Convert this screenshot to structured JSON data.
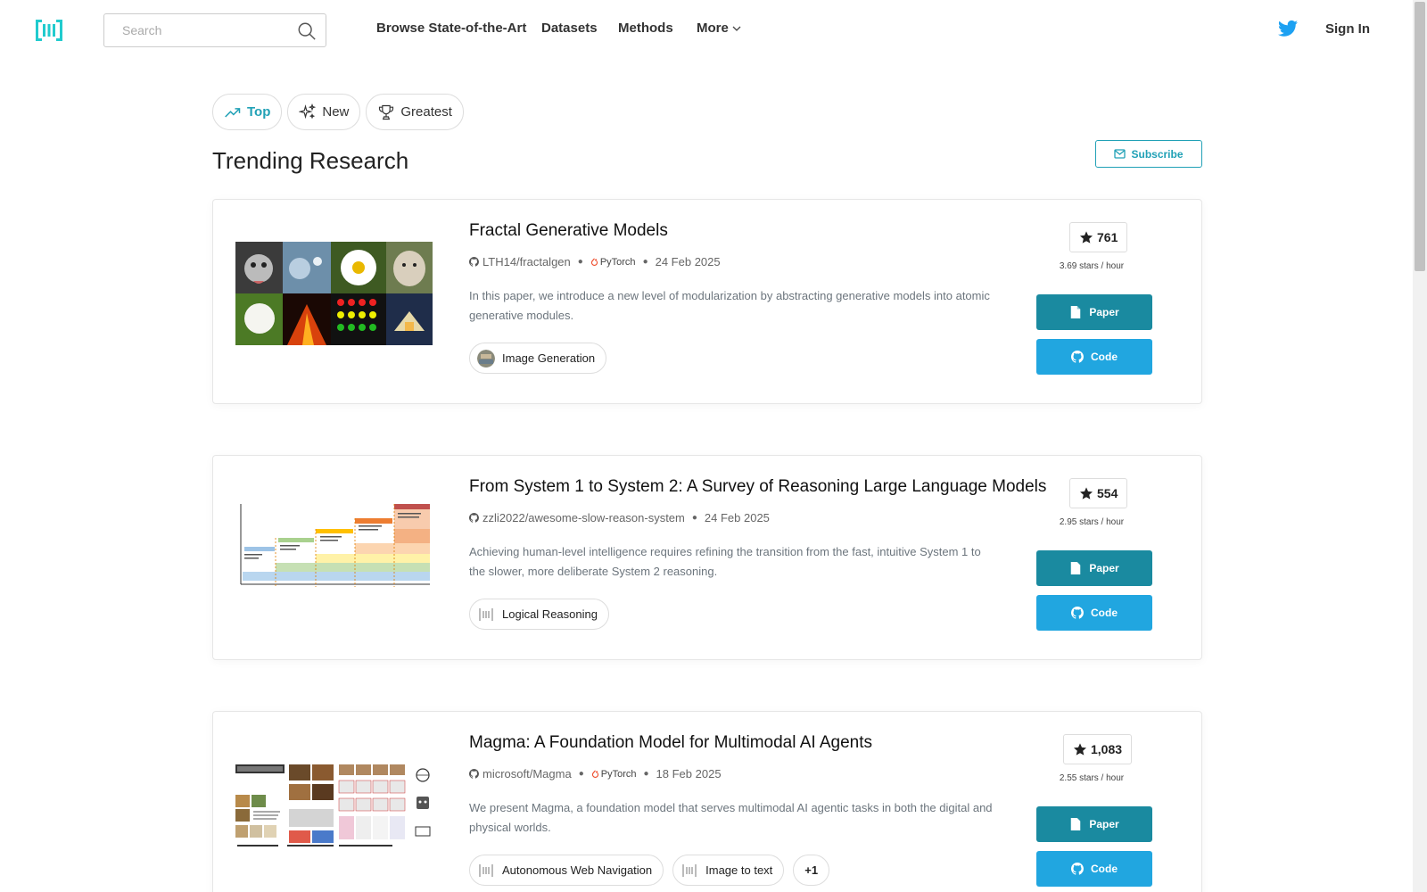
{
  "nav": {
    "search_placeholder": "Search",
    "links": [
      "Browse State-of-the-Art",
      "Datasets",
      "Methods",
      "More"
    ],
    "sign_in": "Sign In"
  },
  "tabs": [
    {
      "label": "Top",
      "icon": "trending-up-icon",
      "active": true
    },
    {
      "label": "New",
      "icon": "sparkles-icon",
      "active": false
    },
    {
      "label": "Greatest",
      "icon": "trophy-icon",
      "active": false
    }
  ],
  "heading": "Trending Research",
  "subscribe_label": "Subscribe",
  "papers": [
    {
      "title": "Fractal Generative Models",
      "repo": "LTH14/fractalgen",
      "framework": "PyTorch",
      "date": "24 Feb 2025",
      "abstract": "In this paper, we introduce a new level of modularization by abstracting generative models into atomic generative modules.",
      "tags": [
        "Image Generation"
      ],
      "stars": "761",
      "rate": "3.69 stars / hour",
      "paper_label": "Paper",
      "code_label": "Code"
    },
    {
      "title": "From System 1 to System 2: A Survey of Reasoning Large Language Models",
      "repo": "zzli2022/awesome-slow-reason-system",
      "framework": "",
      "date": "24 Feb 2025",
      "abstract": "Achieving human-level intelligence requires refining the transition from the fast, intuitive System 1 to the slower, more deliberate System 2 reasoning.",
      "tags": [
        "Logical Reasoning"
      ],
      "stars": "554",
      "rate": "2.95 stars / hour",
      "paper_label": "Paper",
      "code_label": "Code"
    },
    {
      "title": "Magma: A Foundation Model for Multimodal AI Agents",
      "repo": "microsoft/Magma",
      "framework": "PyTorch",
      "date": "18 Feb 2025",
      "abstract": "We present Magma, a foundation model that serves multimodal AI agentic tasks in both the digital and physical worlds.",
      "tags": [
        "Autonomous Web Navigation",
        "Image to text"
      ],
      "more_tags": "+1",
      "stars": "1,083",
      "rate": "2.55 stars / hour",
      "paper_label": "Paper",
      "code_label": "Code"
    }
  ],
  "colors": {
    "accent": "#21a1b6",
    "paper_button": "#1a8aa0",
    "code_button": "#21a6e0",
    "twitter": "#1da1f2"
  }
}
